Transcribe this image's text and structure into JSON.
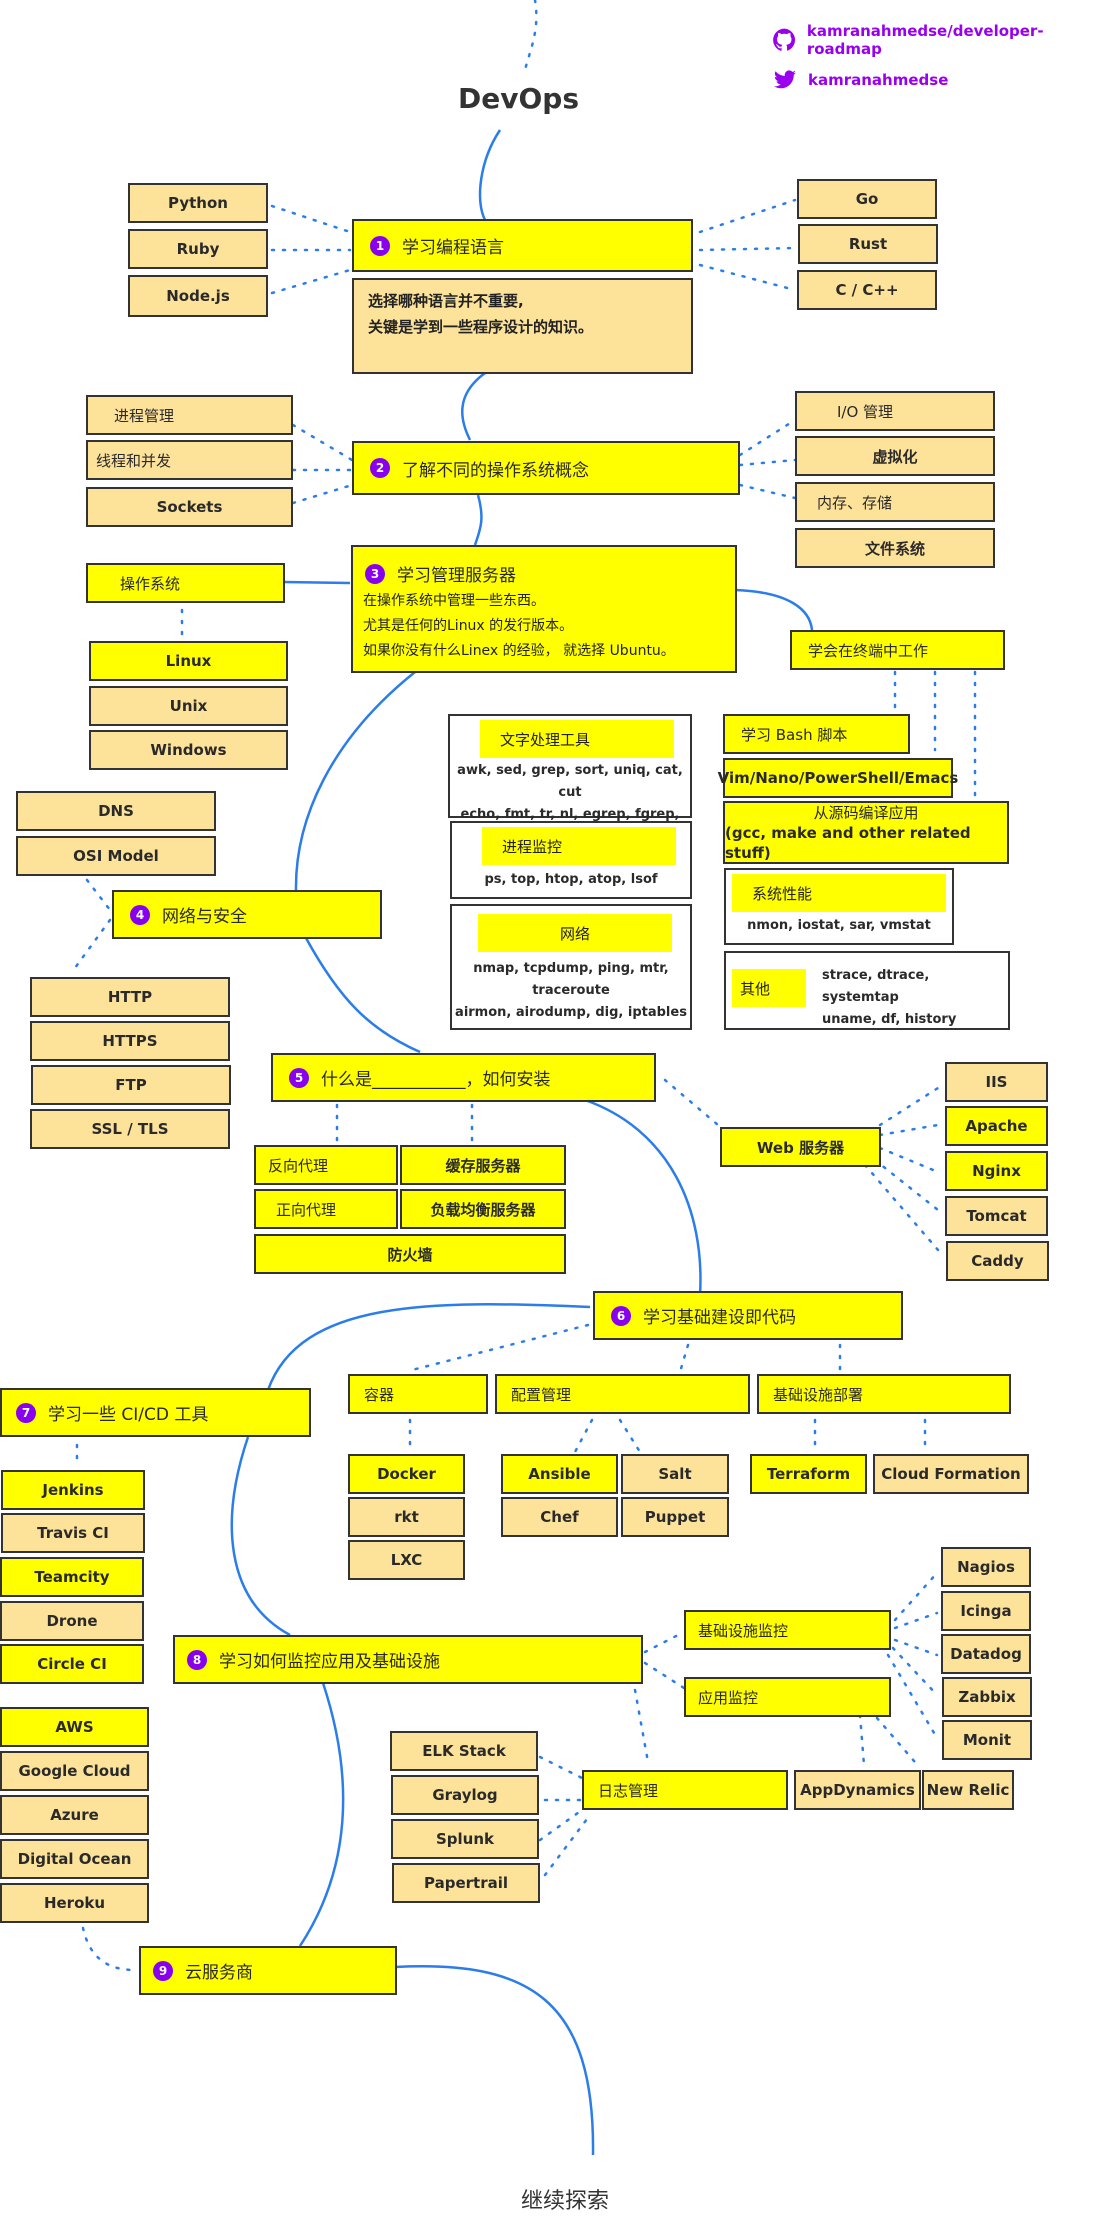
{
  "header": {
    "title": "DevOps",
    "github_label": "kamranahmedse/developer-roadmap",
    "twitter_label": "kamranahmedse",
    "accent_color": "#9900ee"
  },
  "colors": {
    "required": "#ffff00",
    "optional": "#fde29a",
    "line": "#2b7de9",
    "number_badge": "#8800ee"
  },
  "steps": [
    {
      "num": "1",
      "label": "学习编程语言"
    },
    {
      "num": "2",
      "label": "了解不同的操作系统概念"
    },
    {
      "num": "3",
      "label": "学习管理服务器"
    },
    {
      "num": "4",
      "label": "网络与安全"
    },
    {
      "num": "5",
      "label": "什么是___________，如何安装"
    },
    {
      "num": "6",
      "label": "学习基础建设即代码"
    },
    {
      "num": "7",
      "label": "学习一些 CI/CD 工具"
    },
    {
      "num": "8",
      "label": "学习如何监控应用及基础设施"
    },
    {
      "num": "9",
      "label": "云服务商"
    }
  ],
  "languages": {
    "left": [
      "Python",
      "Ruby",
      "Node.js"
    ],
    "right": [
      "Go",
      "Rust",
      "C / C++"
    ],
    "note": [
      "选择哪种语言并不重要,",
      "关键是学到一些程序设计的知识。"
    ]
  },
  "os_concepts": {
    "left": [
      "进程管理",
      "线程和并发",
      "Sockets"
    ],
    "right": [
      "I/O 管理",
      "虚拟化",
      "内存、存储",
      "文件系统"
    ]
  },
  "servers": {
    "description": [
      "在操作系统中管理一些东西。",
      "尤其是任何的Linux 的发行版本。",
      "如果你没有什么Linex 的经验， 就选择 Ubuntu。"
    ],
    "os_label": "操作系统",
    "os_items": [
      "Linux",
      "Unix",
      "Windows"
    ],
    "terminal_label": "学会在终端中工作",
    "text_tools": {
      "title": "文字处理工具",
      "lines": [
        "awk, sed, grep, sort, uniq, cat, cut",
        "echo, fmt, tr, nl, egrep, fgrep, wc"
      ]
    },
    "process_monitor": {
      "title": "进程监控",
      "lines": [
        "ps, top, htop, atop, lsof"
      ]
    },
    "network": {
      "title": "网络",
      "lines": [
        "nmap, tcpdump, ping, mtr, traceroute",
        "airmon, airodump, dig, iptables"
      ]
    },
    "bash": "学习 Bash 脚本",
    "editors": "Vim/Nano/PowerShell/Emacs",
    "compile": [
      "从源码编译应用",
      "(gcc, make and other related stuff)"
    ],
    "sys_perf": {
      "title": "系统性能",
      "lines": [
        "nmon, iostat, sar, vmstat"
      ]
    },
    "other": {
      "title": "其他",
      "lines": [
        "strace, dtrace, systemtap",
        "uname, df, history"
      ]
    }
  },
  "networking": {
    "top": [
      "DNS",
      "OSI Model"
    ],
    "bottom": [
      "HTTP",
      "HTTPS",
      "FTP",
      "SSL / TLS"
    ]
  },
  "install": {
    "items": [
      "反向代理",
      "缓存服务器",
      "正向代理",
      "负载均衡服务器",
      "防火墙"
    ],
    "web_server_label": "Web 服务器",
    "web_servers": [
      "IIS",
      "Apache",
      "Nginx",
      "Tomcat",
      "Caddy"
    ]
  },
  "iac": {
    "groups": [
      "容器",
      "配置管理",
      "基础设施部署"
    ],
    "containers": [
      "Docker",
      "rkt",
      "LXC"
    ],
    "config": [
      "Ansible",
      "Salt",
      "Chef",
      "Puppet"
    ],
    "provisioning": [
      "Terraform",
      "Cloud Formation"
    ]
  },
  "cicd": [
    "Jenkins",
    "Travis CI",
    "Teamcity",
    "Drone",
    "Circle CI"
  ],
  "cloud": [
    "AWS",
    "Google Cloud",
    "Azure",
    "Digital Ocean",
    "Heroku"
  ],
  "monitoring": {
    "infra_label": "基础设施监控",
    "app_label": "应用监控",
    "logs_label": "日志管理",
    "infra_tools": [
      "Nagios",
      "Icinga",
      "Datadog",
      "Zabbix",
      "Monit"
    ],
    "app_tools": [
      "AppDynamics",
      "New Relic"
    ],
    "log_tools": [
      "ELK Stack",
      "Graylog",
      "Splunk",
      "Papertrail"
    ]
  },
  "footer": {
    "continue_label": "继续探索"
  }
}
